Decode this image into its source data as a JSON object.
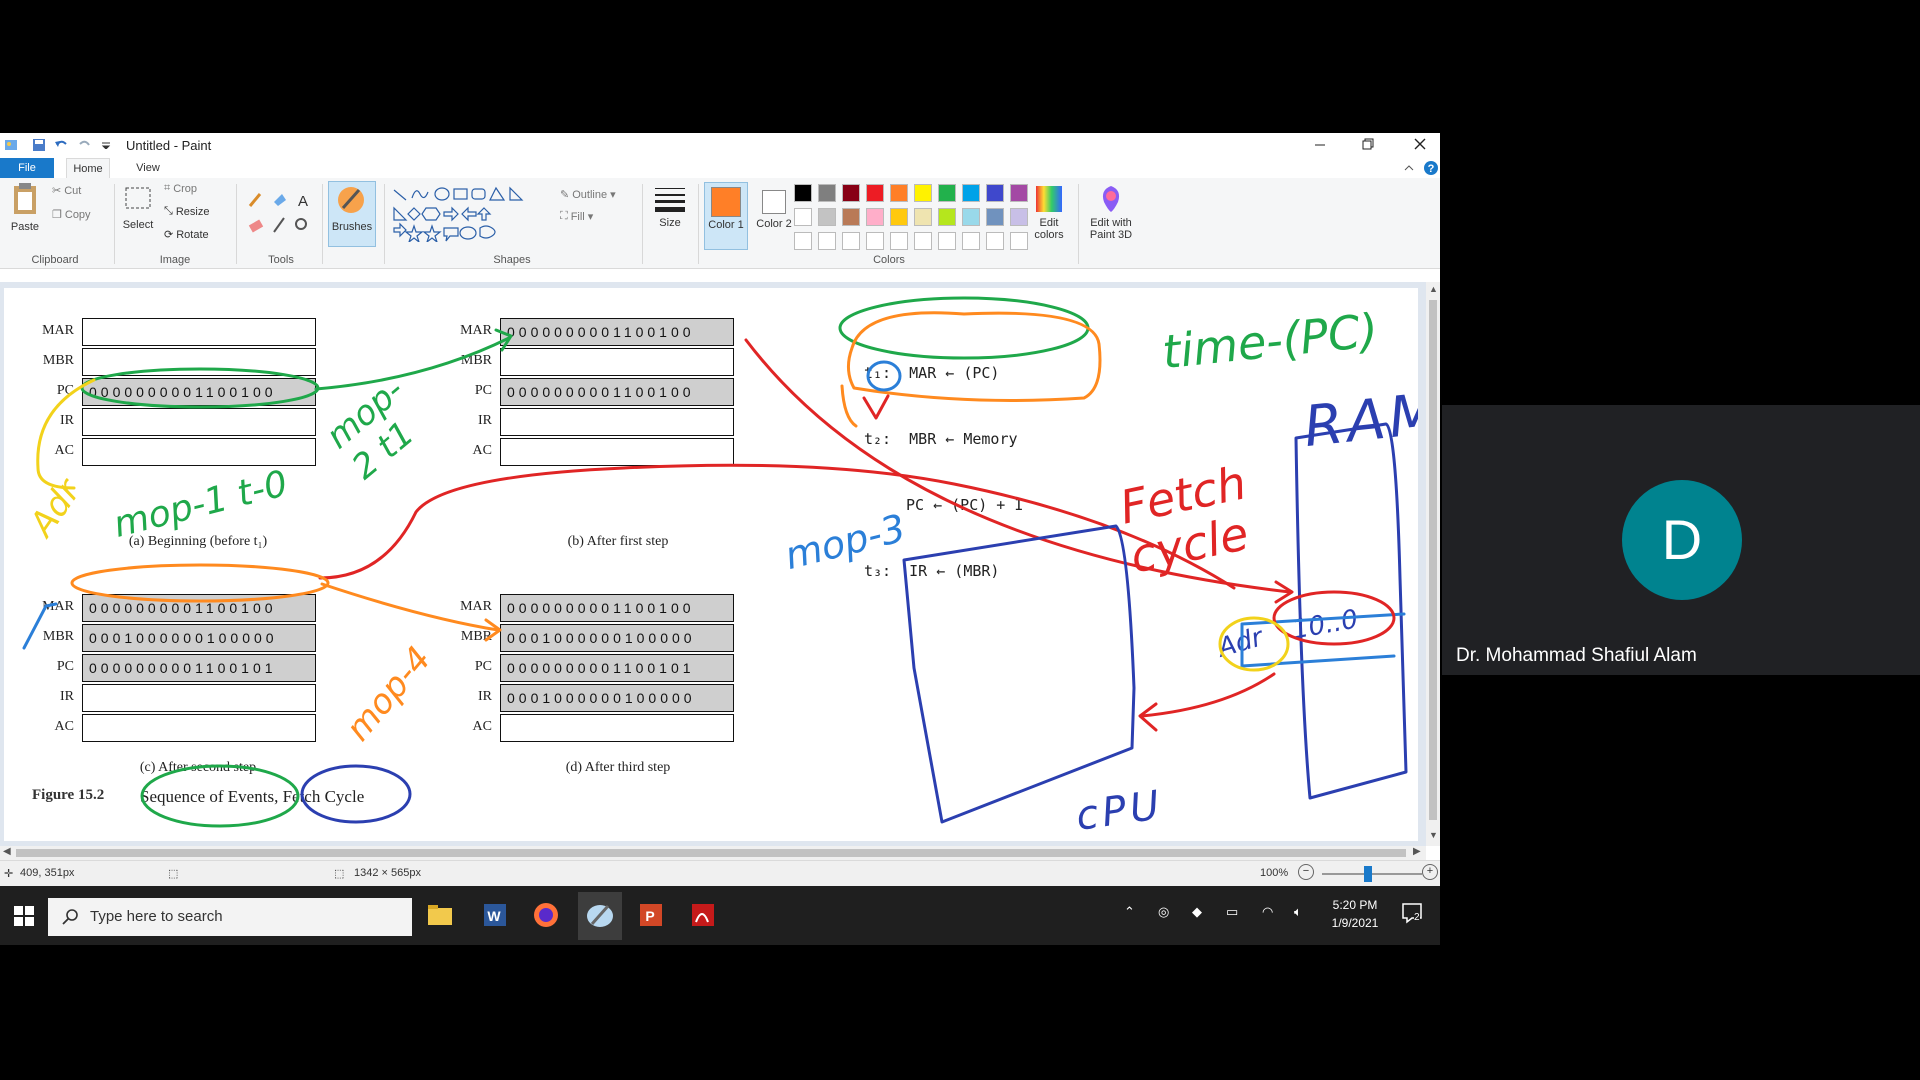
{
  "window": {
    "title": "Untitled - Paint"
  },
  "menu": {
    "tabs": [
      "File",
      "Home",
      "View"
    ]
  },
  "ribbon": {
    "clipboard": {
      "paste": "Paste",
      "cut": "Cut",
      "copy": "Copy",
      "group": "Clipboard"
    },
    "image": {
      "select": "Select",
      "crop": "Crop",
      "resize": "Resize",
      "rotate": "Rotate",
      "group": "Image"
    },
    "tools": {
      "group": "Tools"
    },
    "brushes": "Brushes",
    "shapes": {
      "outline": "Outline",
      "fill": "Fill",
      "group": "Shapes"
    },
    "size": "Size",
    "color1": "Color 1",
    "color2": "Color 2",
    "colors_group": "Colors",
    "edit_colors": "Edit colors",
    "edit_paint3d": "Edit with Paint 3D",
    "palette_row1": [
      "#000000",
      "#7f7f7f",
      "#880015",
      "#ed1c24",
      "#ff7f27",
      "#fff200",
      "#22b14c",
      "#00a2e8",
      "#3f48cc",
      "#a349a4"
    ],
    "palette_row2": [
      "#ffffff",
      "#c3c3c3",
      "#b97a57",
      "#ffaec9",
      "#ffc90e",
      "#efe4b0",
      "#b5e61d",
      "#99d9ea",
      "#7092be",
      "#c8bfe7"
    ],
    "color1_value": "#ff7f27"
  },
  "figure": {
    "panel_a": {
      "caption": "(a) Beginning (before t₁)",
      "MAR": "",
      "MBR": "",
      "PC": "0000000001100100",
      "IR": "",
      "AC": ""
    },
    "panel_b": {
      "caption": "(b) After first step",
      "MAR": "0000000001100100",
      "MBR": "",
      "PC": "0000000001100100",
      "IR": "",
      "AC": ""
    },
    "panel_c": {
      "caption": "(c) After second step",
      "MAR": "0000000001100100",
      "MBR": "0001000000100000",
      "PC": "0000000001100101",
      "IR": "",
      "AC": ""
    },
    "panel_d": {
      "caption": "(d) After third step",
      "MAR": "0000000001100100",
      "MBR": "0001000000100000",
      "PC": "0000000001100101",
      "IR": "0001000000100000",
      "AC": ""
    },
    "register_labels": [
      "MAR",
      "MBR",
      "PC",
      "IR",
      "AC"
    ],
    "figure_num": "Figure 15.2",
    "figure_title": "Sequence of Events, Fetch Cycle",
    "steps": {
      "t1": "t₁:  MAR ← (PC)",
      "t2a": "t₂:  MBR ← Memory",
      "t2b": "PC ← (PC) + I",
      "t3": "t₃:  IR ← (MBR)"
    }
  },
  "annotations": {
    "time_pc": "time-(PC)",
    "ram": "RAM",
    "fetch_cycle": "Fetch cycle",
    "mop1": "mop-1 t-0",
    "mop2": "mop-2 t1",
    "mop3": "mop-3",
    "mop4": "mop-4",
    "addr": "Adr",
    "addr2": "Adr",
    "ram_value": "10..0",
    "cpu": "cPU"
  },
  "status": {
    "cursor": "409, 351px",
    "canvas_size": "1342 × 565px",
    "zoom": "100%"
  },
  "taskbar": {
    "search_placeholder": "Type here to search",
    "time": "5:20 PM",
    "date": "1/9/2021",
    "notif_count": "2"
  },
  "participant": {
    "initial": "D",
    "name": "Dr. Mohammad Shafiul Alam",
    "avatar_color": "#00838f"
  }
}
